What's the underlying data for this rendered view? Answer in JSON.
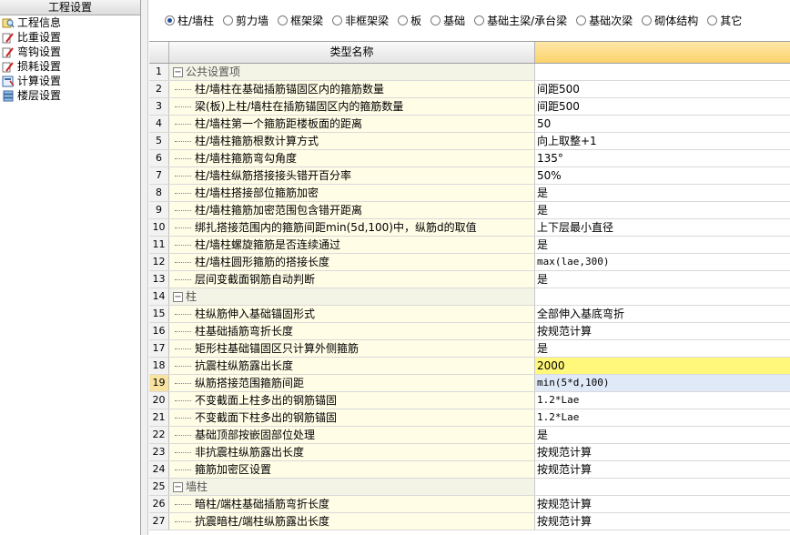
{
  "left_panel": {
    "title": "工程设置",
    "items": [
      {
        "label": "工程信息",
        "icon": "magnifier-icon"
      },
      {
        "label": "比重设置",
        "icon": "pencil-icon"
      },
      {
        "label": "弯钩设置",
        "icon": "pencil-icon"
      },
      {
        "label": "损耗设置",
        "icon": "pencil-icon"
      },
      {
        "label": "计算设置",
        "icon": "calculator-icon"
      },
      {
        "label": "楼层设置",
        "icon": "floors-icon"
      }
    ]
  },
  "radio_bar": {
    "options": [
      {
        "label": "柱/墙柱",
        "checked": true
      },
      {
        "label": "剪力墙",
        "checked": false
      },
      {
        "label": "框架梁",
        "checked": false
      },
      {
        "label": "非框架梁",
        "checked": false
      },
      {
        "label": "板",
        "checked": false
      },
      {
        "label": "基础",
        "checked": false
      },
      {
        "label": "基础主梁/承台梁",
        "checked": false
      },
      {
        "label": "基础次梁",
        "checked": false
      },
      {
        "label": "砌体结构",
        "checked": false
      },
      {
        "label": "其它",
        "checked": false
      }
    ]
  },
  "grid": {
    "header_name": "类型名称",
    "rows": [
      {
        "num": "1",
        "name": "公共设置项",
        "value": "",
        "group": true
      },
      {
        "num": "2",
        "name": "柱/墙柱在基础插筋锚固区内的箍筋数量",
        "value": "间距500"
      },
      {
        "num": "3",
        "name": "梁(板)上柱/墙柱在插筋锚固区内的箍筋数量",
        "value": "间距500"
      },
      {
        "num": "4",
        "name": "柱/墙柱第一个箍筋距楼板面的距离",
        "value": "50"
      },
      {
        "num": "5",
        "name": "柱/墙柱箍筋根数计算方式",
        "value": "向上取整+1"
      },
      {
        "num": "6",
        "name": "柱/墙柱箍筋弯勾角度",
        "value": "135°"
      },
      {
        "num": "7",
        "name": "柱/墙柱纵筋搭接接头错开百分率",
        "value": "50%"
      },
      {
        "num": "8",
        "name": "柱/墙柱搭接部位箍筋加密",
        "value": "是"
      },
      {
        "num": "9",
        "name": "柱/墙柱箍筋加密范围包含错开距离",
        "value": "是"
      },
      {
        "num": "10",
        "name": "绑扎搭接范围内的箍筋间距min(5d,100)中，纵筋d的取值",
        "value": "上下层最小直径"
      },
      {
        "num": "11",
        "name": "柱/墙柱螺旋箍筋是否连续通过",
        "value": "是"
      },
      {
        "num": "12",
        "name": "柱/墙柱圆形箍筋的搭接长度",
        "value": "max(lae,300)",
        "mono": true
      },
      {
        "num": "13",
        "name": "层间变截面钢筋自动判断",
        "value": "是"
      },
      {
        "num": "14",
        "name": "柱",
        "value": "",
        "group": true
      },
      {
        "num": "15",
        "name": "柱纵筋伸入基础锚固形式",
        "value": "全部伸入基底弯折"
      },
      {
        "num": "16",
        "name": "柱基础插筋弯折长度",
        "value": "按规范计算"
      },
      {
        "num": "17",
        "name": "矩形柱基础锚固区只计算外侧箍筋",
        "value": "是"
      },
      {
        "num": "18",
        "name": "抗震柱纵筋露出长度",
        "value": "2000",
        "highlight": true
      },
      {
        "num": "19",
        "name": "纵筋搭接范围箍筋间距",
        "value": "min(5*d,100)",
        "mono": true,
        "selected": true
      },
      {
        "num": "20",
        "name": "不变截面上柱多出的钢筋锚固",
        "value": "1.2*Lae",
        "mono": true
      },
      {
        "num": "21",
        "name": "不变截面下柱多出的钢筋锚固",
        "value": "1.2*Lae",
        "mono": true
      },
      {
        "num": "22",
        "name": "基础顶部按嵌固部位处理",
        "value": "是"
      },
      {
        "num": "23",
        "name": "非抗震柱纵筋露出长度",
        "value": "按规范计算"
      },
      {
        "num": "24",
        "name": "箍筋加密区设置",
        "value": "按规范计算"
      },
      {
        "num": "25",
        "name": "墙柱",
        "value": "",
        "group": true
      },
      {
        "num": "26",
        "name": "暗柱/端柱基础插筋弯折长度",
        "value": "按规范计算"
      },
      {
        "num": "27",
        "name": "抗震暗柱/端柱纵筋露出长度",
        "value": "按规范计算"
      }
    ]
  }
}
